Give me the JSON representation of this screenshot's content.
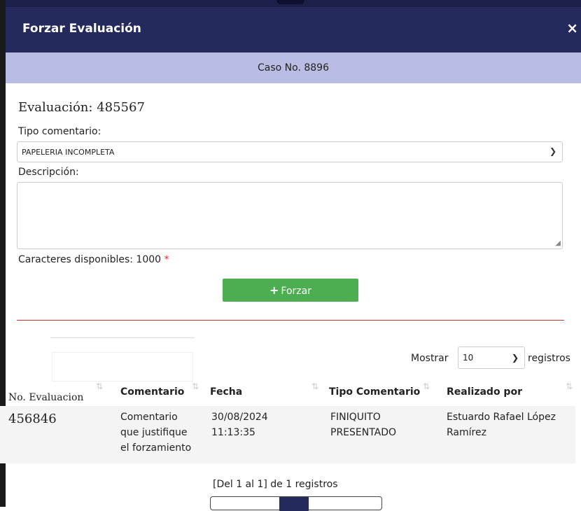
{
  "modal": {
    "title": "Forzar Evaluación",
    "close": "×"
  },
  "case_bar": "Caso No. 8896",
  "form": {
    "evaluacion_label": "Evaluación:",
    "evaluacion_value": "485567",
    "tipo_label": "Tipo comentario:",
    "tipo_value": "PAPELERIA INCOMPLETA",
    "descripcion_label": "Descripción:",
    "chars_label": "Caracteres disponibles: 1000",
    "required_mark": "*",
    "forzar_button": "Forzar"
  },
  "table": {
    "mostrar": "Mostrar",
    "length_value": "10",
    "registros": "registros",
    "columns": [
      "No. Evaluacion",
      "Comentario",
      "Fecha",
      "Tipo Comentario",
      "Realizado por"
    ],
    "rows": [
      {
        "evaluacion": "456846",
        "comentario": [
          "Comentario",
          "que justifique",
          "el forzamiento"
        ],
        "fecha": [
          "30/08/2024",
          "11:13:35"
        ],
        "tipo": [
          "FINIQUITO",
          "PRESENTADO"
        ],
        "realizado": [
          "Estuardo Rafael López",
          "Ramírez"
        ]
      }
    ],
    "info": "[Del 1 al 1] de 1 registros"
  }
}
